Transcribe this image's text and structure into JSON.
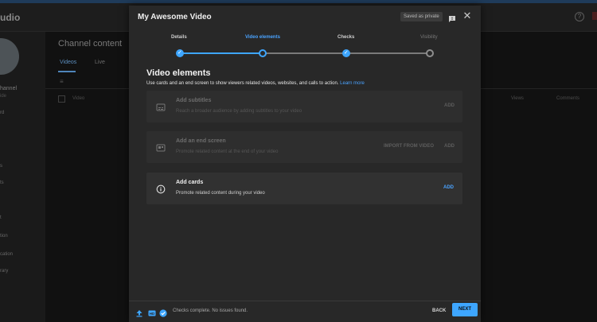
{
  "background": {
    "logo_fragment": "udio",
    "channel_name": "hannel",
    "channel_sub": "ide",
    "nav_items": [
      "rd",
      "",
      "s",
      "ts",
      "t",
      "tion",
      "cation",
      "rary"
    ],
    "channel_content_title": "Channel content",
    "tabs": [
      "Videos",
      "Live"
    ],
    "filter_icon": "filter-icon",
    "columns": [
      "Video",
      "Views",
      "Comments"
    ]
  },
  "modal": {
    "title": "My Awesome Video",
    "saved_badge": "Saved as private",
    "feedback_icon": "feedback-icon",
    "close_icon": "close-icon",
    "steps": [
      {
        "label": "Details",
        "status": "done"
      },
      {
        "label": "Video elements",
        "status": "current"
      },
      {
        "label": "Checks",
        "status": "done"
      },
      {
        "label": "Visibility",
        "status": "pending"
      }
    ],
    "section_title": "Video elements",
    "section_desc": "Use cards and an end screen to show viewers related videos, websites, and calls to action.",
    "learn_more": "Learn more",
    "cards": [
      {
        "title": "Add subtitles",
        "subtitle": "Reach a broader audience by adding subtitles to your video",
        "actions": [
          "ADD"
        ],
        "enabled": false,
        "icon": "subtitles-icon"
      },
      {
        "title": "Add an end screen",
        "subtitle": "Promote related content at the end of your video",
        "actions": [
          "IMPORT FROM VIDEO",
          "ADD"
        ],
        "enabled": false,
        "icon": "end-screen-icon"
      },
      {
        "title": "Add cards",
        "subtitle": "Promote related content during your video",
        "actions": [
          "ADD"
        ],
        "enabled": true,
        "icon": "info-icon"
      }
    ],
    "footer": {
      "icons": [
        "upload-icon",
        "hd-icon",
        "check-circle-icon"
      ],
      "status": "Checks complete. No issues found.",
      "back": "BACK",
      "next": "NEXT"
    }
  },
  "colors": {
    "accent": "#3ea6ff",
    "modal_bg": "#282828",
    "card_bg": "#313131"
  }
}
